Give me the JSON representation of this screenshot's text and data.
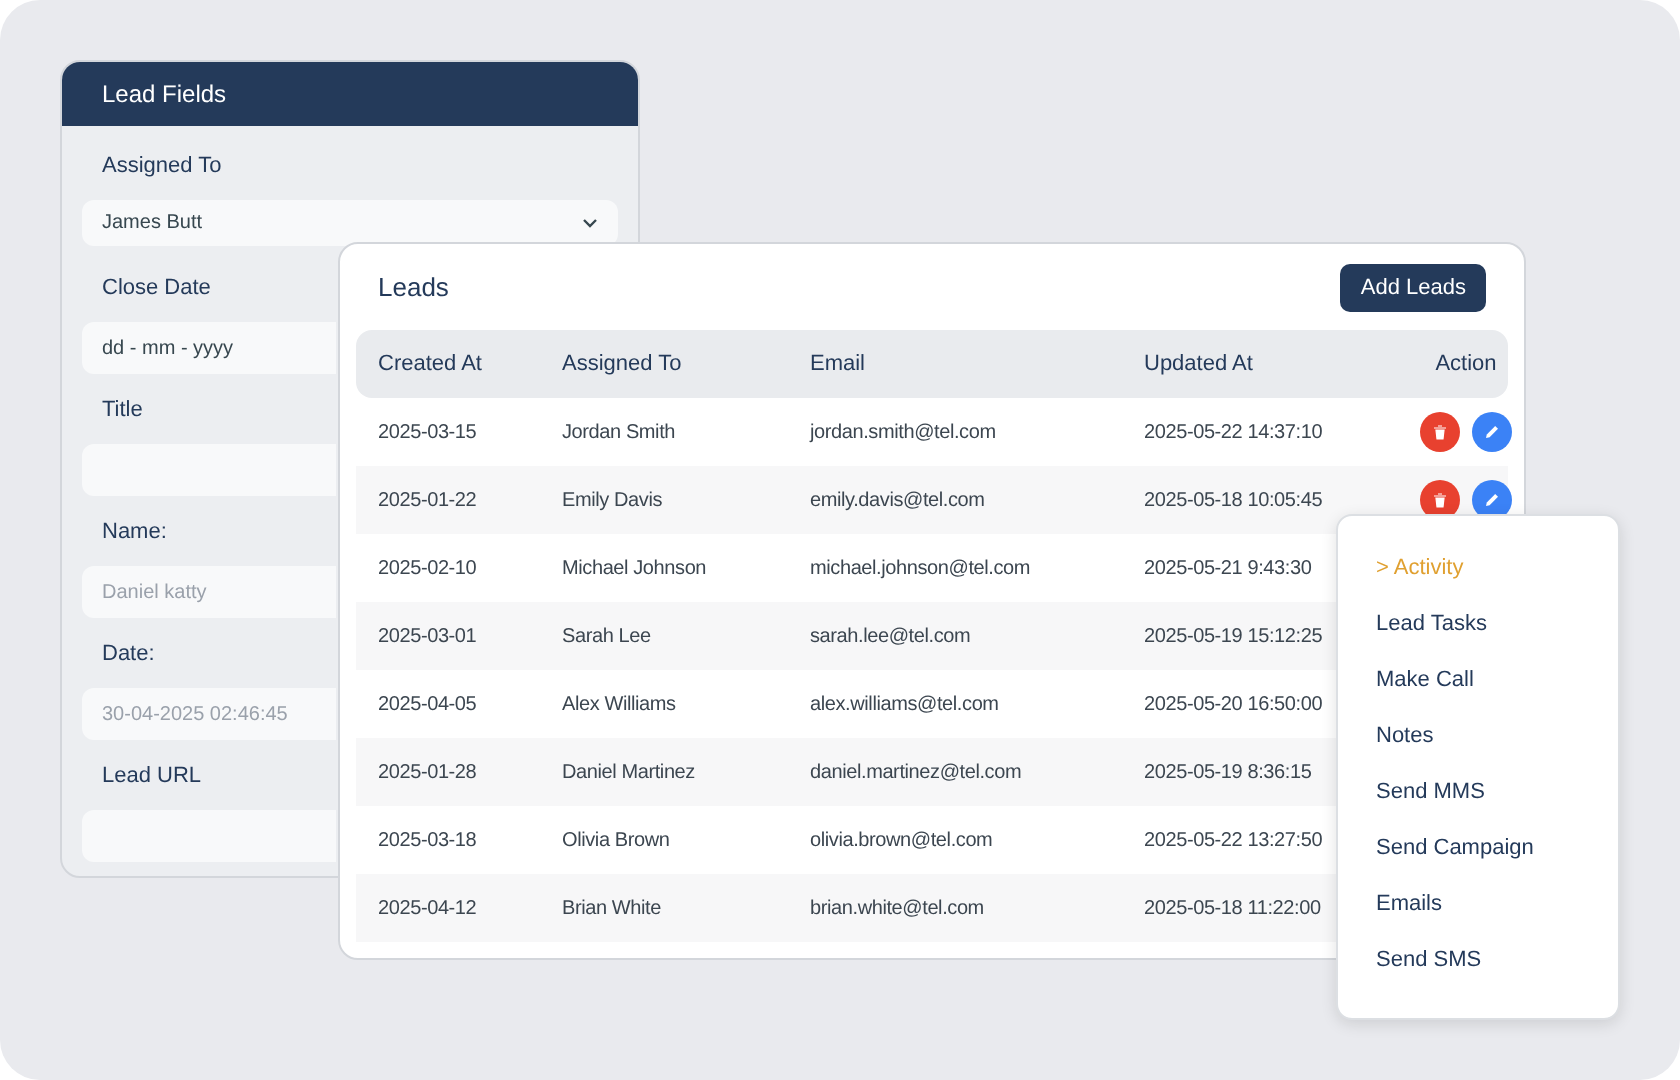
{
  "lead_fields": {
    "title": "Lead Fields",
    "fields": [
      {
        "label": "Assigned To",
        "kind": "select",
        "value": "James Butt"
      },
      {
        "label": "Close Date",
        "kind": "text",
        "value": "dd - mm - yyyy"
      },
      {
        "label": "Title",
        "kind": "text"
      },
      {
        "label": "Name:",
        "kind": "text",
        "placeholder": "Daniel katty"
      },
      {
        "label": "Date:",
        "kind": "text",
        "placeholder": "30-04-2025 02:46:45"
      },
      {
        "label": "Lead URL",
        "kind": "text"
      }
    ]
  },
  "leads": {
    "title": "Leads",
    "add_button": "Add Leads",
    "table": {
      "columns": [
        "Created At",
        "Assigned To",
        "Email",
        "Updated At",
        "Action"
      ],
      "rows": [
        {
          "cells": [
            "2025-03-15",
            "Jordan Smith",
            "jordan.smith@tel.com",
            "2025-05-22 14:37:10"
          ],
          "actions": [
            {
              "kind": "delete"
            },
            {
              "kind": "edit"
            }
          ]
        },
        {
          "cells": [
            "2025-01-22",
            "Emily Davis",
            "emily.davis@tel.com",
            "2025-05-18 10:05:45"
          ],
          "actions": [
            {
              "kind": "delete"
            },
            {
              "kind": "edit"
            }
          ]
        },
        {
          "cells": [
            "2025-02-10",
            "Michael Johnson",
            "michael.johnson@tel.com",
            "2025-05-21 9:43:30"
          ]
        },
        {
          "cells": [
            "2025-03-01",
            "Sarah Lee",
            "sarah.lee@tel.com",
            "2025-05-19 15:12:25"
          ]
        },
        {
          "cells": [
            "2025-04-05",
            "Alex Williams",
            "alex.williams@tel.com",
            "2025-05-20 16:50:00"
          ]
        },
        {
          "cells": [
            "2025-01-28",
            "Daniel Martinez",
            "daniel.martinez@tel.com",
            "2025-05-19 8:36:15"
          ]
        },
        {
          "cells": [
            "2025-03-18",
            "Olivia Brown",
            "olivia.brown@tel.com",
            "2025-05-22 13:27:50"
          ]
        },
        {
          "cells": [
            "2025-04-12",
            "Brian White",
            "brian.white@tel.com",
            "2025-05-18 11:22:00"
          ]
        }
      ]
    }
  },
  "action_menu": {
    "items": [
      {
        "label": "> Activity",
        "selected": true
      },
      {
        "label": "Lead Tasks",
        "selected": false
      },
      {
        "label": "Make Call",
        "selected": false
      },
      {
        "label": "Notes",
        "selected": false
      },
      {
        "label": "Send MMS",
        "selected": false
      },
      {
        "label": "Send Campaign",
        "selected": false
      },
      {
        "label": "Emails",
        "selected": false
      },
      {
        "label": "Send SMS",
        "selected": false
      }
    ]
  }
}
